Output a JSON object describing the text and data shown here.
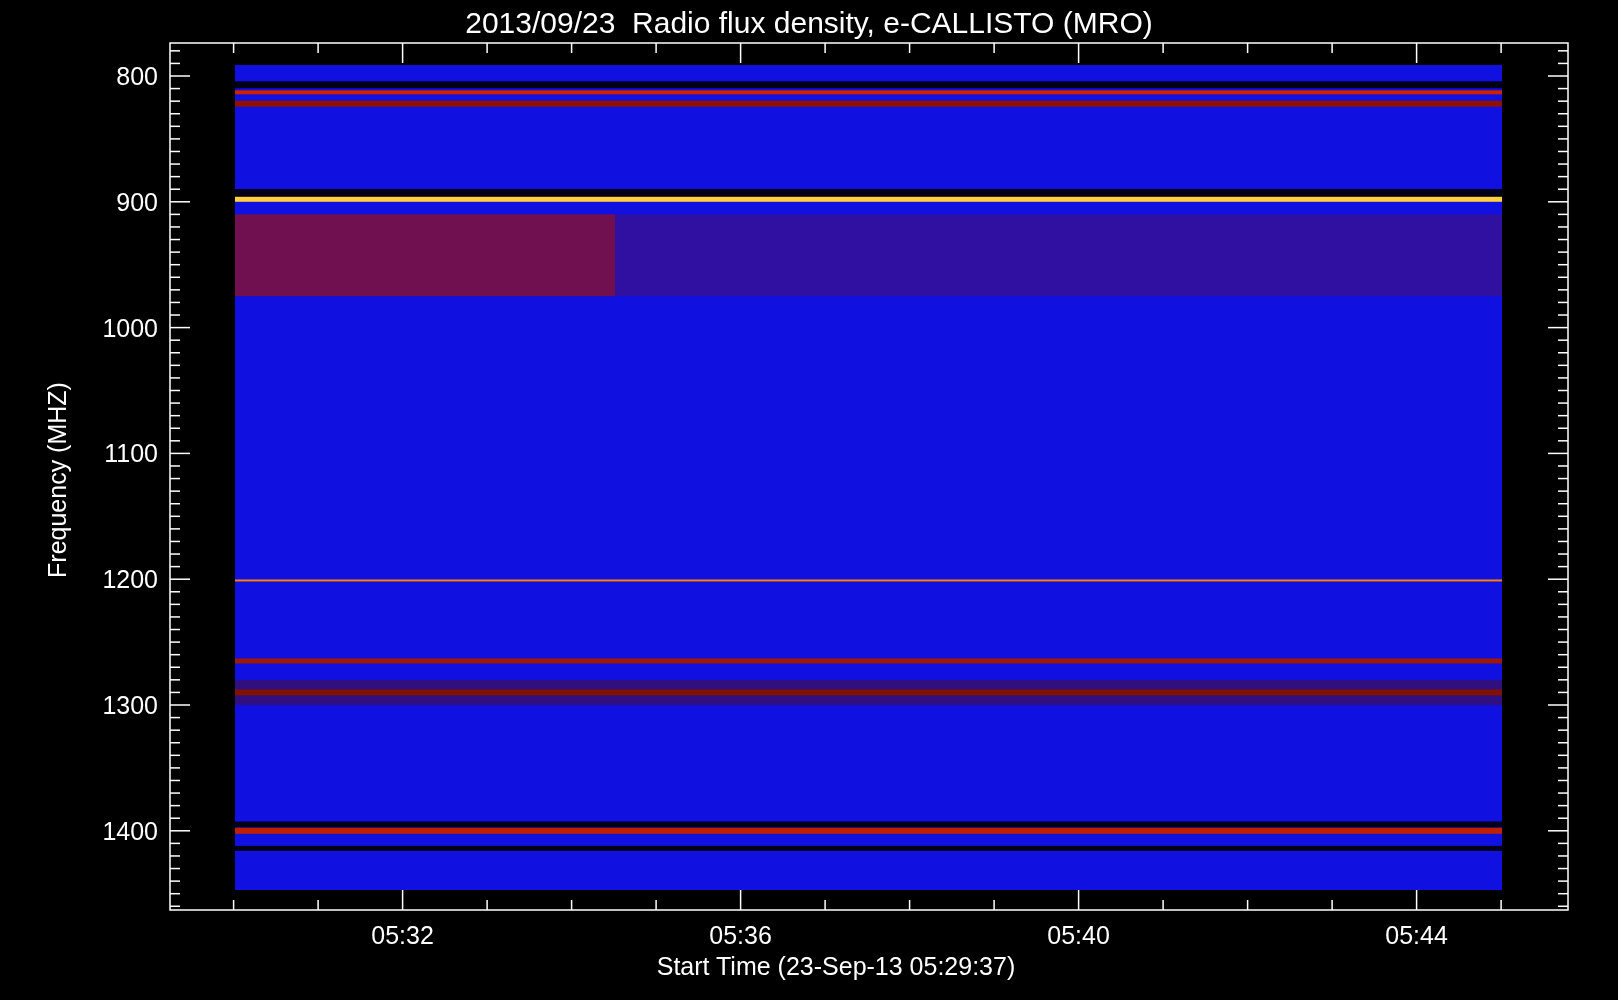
{
  "title": "2013/09/23  Radio flux density, e-CALLISTO (MRO)",
  "ylabel": "Frequency (MHZ)",
  "xlabel": "Start Time (23-Sep-13 05:29:37)",
  "yticks": [
    "800",
    "900",
    "1000",
    "1100",
    "1200",
    "1300",
    "1400"
  ],
  "xticks": [
    "05:32",
    "05:36",
    "05:40",
    "05:44"
  ]
}
